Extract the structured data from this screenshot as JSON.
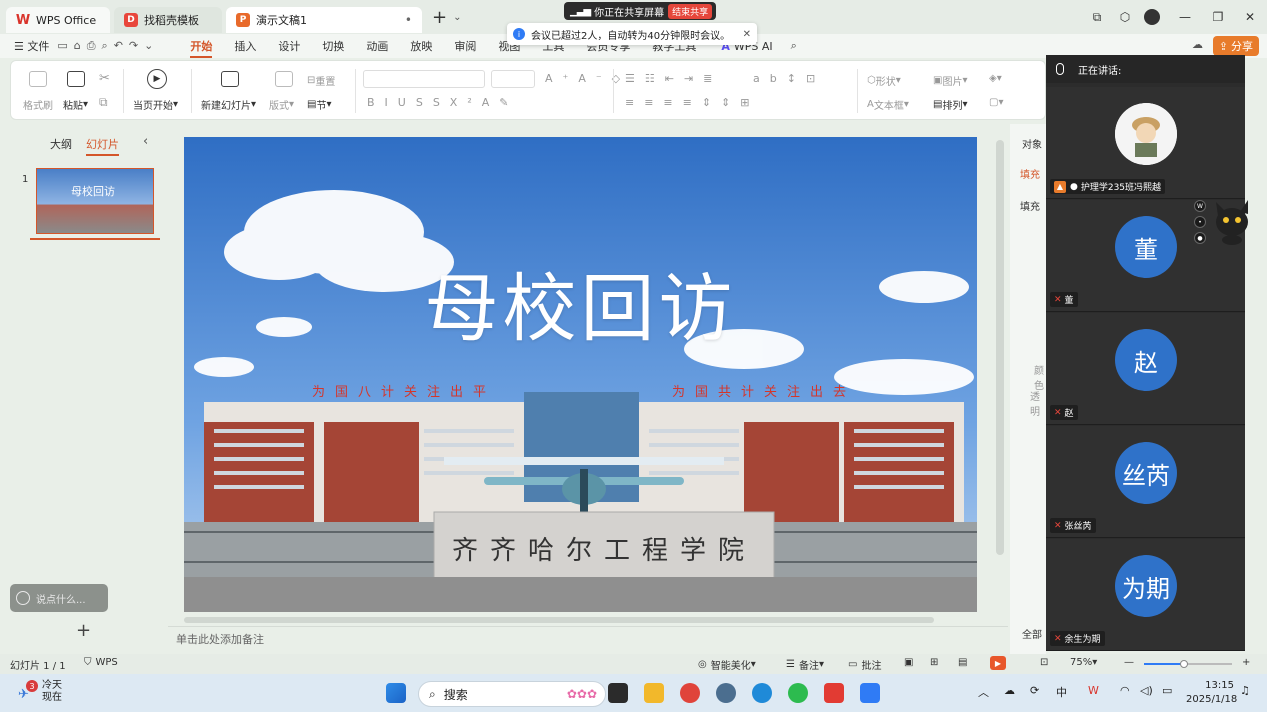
{
  "tabs": {
    "wps": "WPS Office",
    "template": "找稻壳模板",
    "doc": "演示文稿1",
    "doc_dot": "•",
    "add": "+",
    "more": "⌄"
  },
  "share_banner": {
    "text": "你正在共享屏幕",
    "stop": "结束共享"
  },
  "notice": {
    "text": "会议已超过2人，自动转为40分钟限时会议。",
    "close": "✕"
  },
  "menu": {
    "file": "文件",
    "items": [
      "开始",
      "插入",
      "设计",
      "切换",
      "动画",
      "放映",
      "审阅",
      "视图",
      "工具",
      "会员专享",
      "教学工具"
    ],
    "wps_ai": "WPS AI",
    "share": "分享"
  },
  "ribbon": {
    "format_brush": "格式刷",
    "paste": "粘贴",
    "start_from_current": "当页开始",
    "new_slide": "新建幻灯片",
    "layout": "版式",
    "section": "节",
    "reset": "重置",
    "shape": "形状",
    "image": "图片",
    "textbox": "文本框",
    "arrange": "排列"
  },
  "left_panel": {
    "outline_tab": "大纲",
    "slides_tab": "幻灯片",
    "collapse": "‹",
    "slide_number": "1",
    "thumb_title": "母校回访",
    "say_something": "说点什么...",
    "add_slide": "+"
  },
  "slide": {
    "title": "母校回访",
    "banner_left": "为国八计关注出平",
    "banner_right": "为国共计关注出去",
    "sign": "齐齐哈尔工程学院"
  },
  "notes": {
    "placeholder": "单击此处添加备注"
  },
  "right_pane": {
    "object": "对象",
    "fill": "填充",
    "fill_section": "填充",
    "color": "颜色",
    "transparency": "透明",
    "all": "全部"
  },
  "meeting": {
    "speaking_label": "正在讲话:",
    "participants": [
      {
        "name": "护理学235班冯熙越",
        "avatar": "",
        "photo": true,
        "host": true
      },
      {
        "name": "董",
        "avatar": "董",
        "photo": false,
        "host": false
      },
      {
        "name": "赵",
        "avatar": "赵",
        "photo": false,
        "host": false
      },
      {
        "name": "张丝芮",
        "avatar": "丝芮",
        "photo": false,
        "host": false
      },
      {
        "name": "余生为期",
        "avatar": "为期",
        "photo": false,
        "host": false
      }
    ]
  },
  "status": {
    "slide_count": "幻灯片 1 / 1",
    "wps": "WPS",
    "smart_beautify": "智能美化",
    "notes": "备注",
    "comments": "批注",
    "zoom": "75%",
    "zoom_fraction": 0.45
  },
  "taskbar": {
    "weather_badge": "3",
    "weather_line1": "冷天",
    "weather_line2": "现在",
    "search": "搜索",
    "time": "13:15",
    "date": "2025/1/18"
  },
  "colors": {
    "accent": "#d4562a",
    "meeting_bg": "#2c2c2c",
    "avatar_blue": "#2f72c9"
  }
}
